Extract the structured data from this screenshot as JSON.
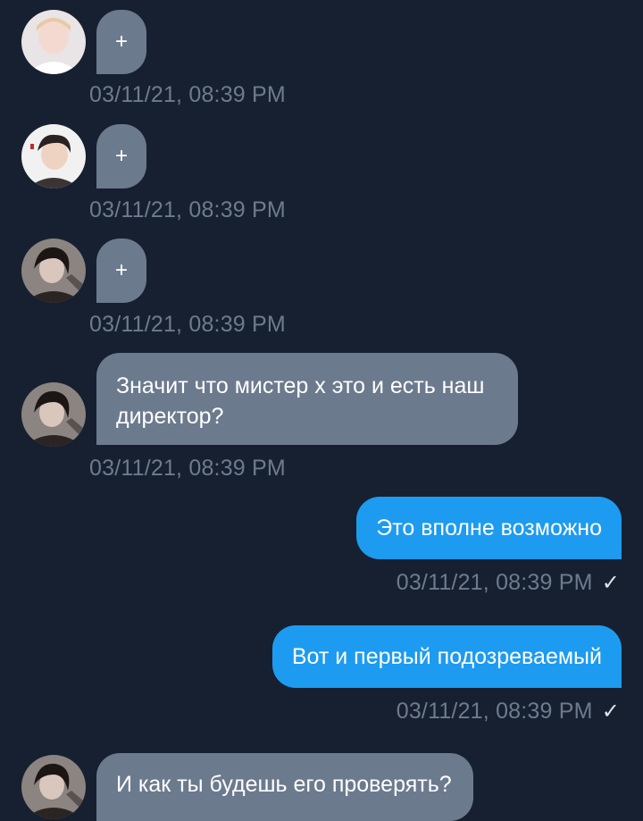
{
  "messages": [
    {
      "side": "in",
      "avatar": "avatar-1",
      "text": "+",
      "time": "03/11/21, 08:39 PM"
    },
    {
      "side": "in",
      "avatar": "avatar-2",
      "text": "+",
      "time": "03/11/21, 08:39 PM"
    },
    {
      "side": "in",
      "avatar": "avatar-3",
      "text": "+",
      "time": "03/11/21, 08:39 PM"
    },
    {
      "side": "in",
      "avatar": "avatar-3",
      "text": "Значит что мистер х это и есть наш директор?",
      "time": "03/11/21, 08:39 PM"
    },
    {
      "side": "out",
      "text": "Это вполне возможно",
      "time": "03/11/21, 08:39 PM",
      "status_icon": "check-icon",
      "status_glyph": "✓"
    },
    {
      "side": "out",
      "text": "Вот и первый подозреваемый",
      "time": "03/11/21, 08:39 PM",
      "status_icon": "check-icon",
      "status_glyph": "✓"
    },
    {
      "side": "in",
      "avatar": "avatar-3",
      "text": "И как ты будешь его проверять?",
      "time": ""
    }
  ],
  "colors": {
    "background": "#172030",
    "incoming_bubble": "#6c7a8e",
    "outgoing_bubble": "#1d9bf0",
    "timestamp": "#6d7b8e"
  }
}
